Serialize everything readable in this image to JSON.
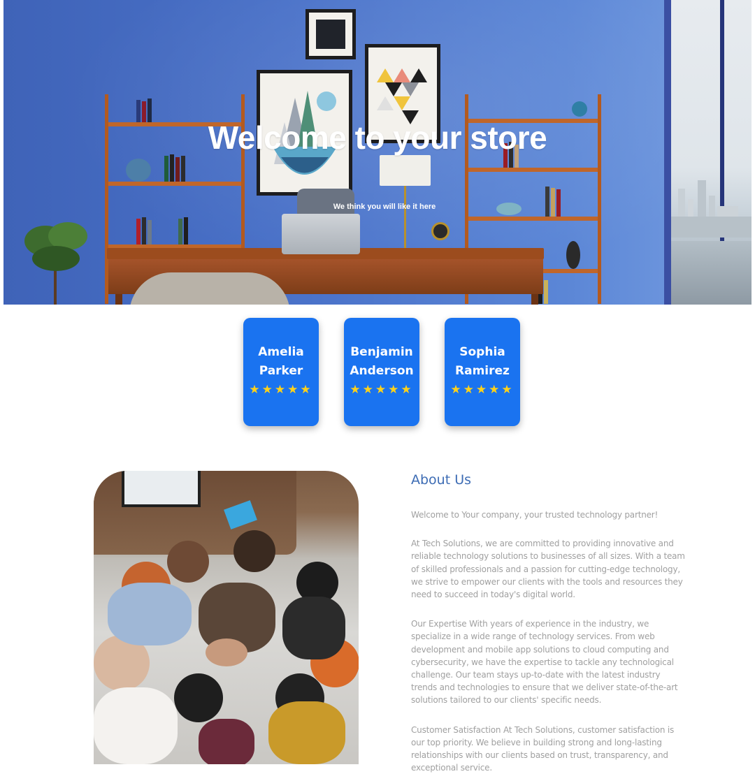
{
  "hero": {
    "title": "Welcome to your store",
    "subtitle": "We think you will like it here"
  },
  "reviews": [
    {
      "name_first": "Amelia",
      "name_last": "Parker",
      "stars": "★★★★★",
      "rating": 5
    },
    {
      "name_first": "Benjamin",
      "name_last": "Anderson",
      "stars": "★★★★★",
      "rating": 5
    },
    {
      "name_first": "Sophia",
      "name_last": "Ramirez",
      "stars": "★★★★★",
      "rating": 5
    }
  ],
  "about": {
    "heading": "About Us",
    "paragraphs": [
      "Welcome to Your company, your trusted technology partner!",
      "At Tech Solutions, we are committed to providing innovative and reliable technology solutions to businesses of all sizes. With a team of skilled professionals and a passion for cutting-edge technology, we strive to empower our clients with the tools and resources they need to succeed in today's digital world.",
      "Our Expertise With years of experience in the industry, we specialize in a wide range of technology services. From web development and mobile app solutions to cloud computing and cybersecurity, we have the expertise to tackle any technological challenge. Our team stays up-to-date with the latest industry trends and technologies to ensure that we deliver state-of-the-art solutions tailored to our clients' specific needs.",
      "Customer Satisfaction At Tech Solutions, customer satisfaction is our top priority. We believe in building strong and long-lasting relationships with our clients based on trust, transparency, and exceptional service."
    ]
  },
  "colors": {
    "card_blue": "#1a73f0",
    "star_yellow": "#ffd21a",
    "heading_blue": "#3d6cb4",
    "body_gray": "#a0a0a0"
  }
}
